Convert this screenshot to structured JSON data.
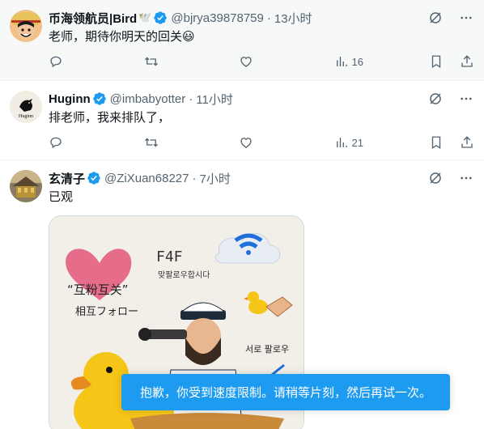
{
  "tweets": [
    {
      "name": "币海领航员|Bird",
      "extra_emoji": "🕊️",
      "handle": "@bjrya39878759",
      "time": "13小时",
      "text": "老师，期待你明天的回关😃",
      "views": "16"
    },
    {
      "name": "Huginn",
      "handle": "@imbabyotter",
      "time": "11小时",
      "text": "排老师，我来排队了，",
      "views": "21",
      "avatar_label": "Huginn"
    },
    {
      "name": "玄清子",
      "handle": "@ZiXuan68227",
      "time": "7小时",
      "text": "已观",
      "image_texts": {
        "f4f": "F4F",
        "korean1": "맞팔로우합시다",
        "mutual": "“互粉互关”",
        "japanese": "相互フォロー",
        "korean2": "서로 팔로우"
      }
    }
  ],
  "toast": "抱歉，你受到速度限制。请稍等片刻，然后再试一次。",
  "colors": {
    "accent": "#1d9bf0",
    "muted": "#536471",
    "text": "#0f1419"
  },
  "icons": [
    "grok-icon",
    "more-icon",
    "reply-icon",
    "retweet-icon",
    "like-icon",
    "views-icon",
    "bookmark-icon",
    "share-icon",
    "verified-icon"
  ]
}
